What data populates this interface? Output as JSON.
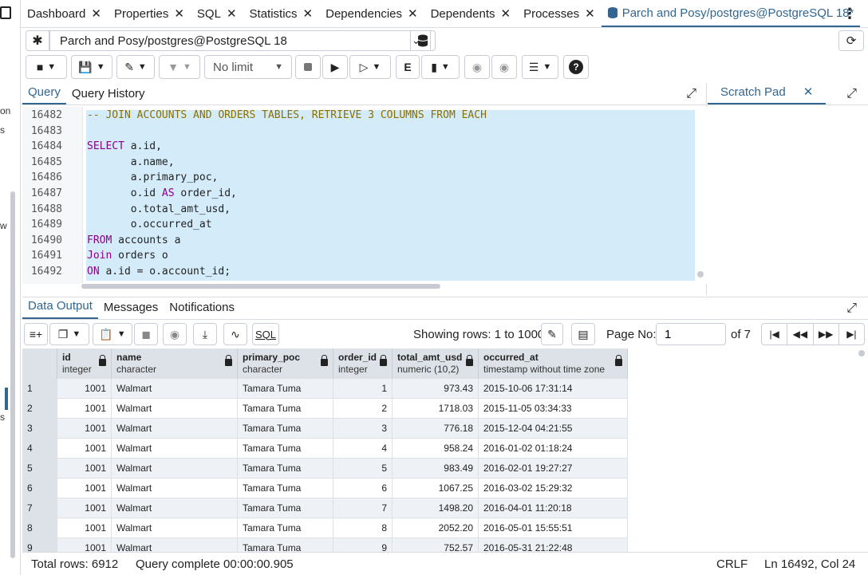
{
  "left_fragments": [
    "on",
    "s",
    "w",
    "s"
  ],
  "tabs": [
    {
      "label": "Dashboard",
      "active": false
    },
    {
      "label": "Properties",
      "active": false
    },
    {
      "label": "SQL",
      "active": false
    },
    {
      "label": "Statistics",
      "active": false
    },
    {
      "label": "Dependencies",
      "active": false
    },
    {
      "label": "Dependents",
      "active": false
    },
    {
      "label": "Processes",
      "active": false
    },
    {
      "label": "Parch and Posy/postgres@PostgreSQL 18*",
      "active": true
    }
  ],
  "connection": {
    "label": "Parch and Posy/postgres@PostgreSQL 18"
  },
  "toolbar": {
    "limit_label": "No limit"
  },
  "query_tabs": [
    "Query",
    "Query History"
  ],
  "scratch_pad": {
    "label": "Scratch Pad"
  },
  "editor": {
    "lines": [
      {
        "num": "16482",
        "text": "-- JOIN ACCOUNTS AND ORDERS TABLES, RETRIEVE 3 COLUMNS FROM EACH"
      },
      {
        "num": "16483",
        "text": ""
      },
      {
        "num": "16484",
        "text": "SELECT a.id,"
      },
      {
        "num": "16485",
        "text": "       a.name,"
      },
      {
        "num": "16486",
        "text": "       a.primary_poc,"
      },
      {
        "num": "16487",
        "text": "       o.id AS order_id,"
      },
      {
        "num": "16488",
        "text": "       o.total_amt_usd,"
      },
      {
        "num": "16489",
        "text": "       o.occurred_at"
      },
      {
        "num": "16490",
        "text": "FROM accounts a"
      },
      {
        "num": "16491",
        "text": "Join orders o"
      },
      {
        "num": "16492",
        "text": "ON a.id = o.account_id;"
      }
    ]
  },
  "output_tabs": [
    "Data Output",
    "Messages",
    "Notifications"
  ],
  "data_toolbar": {
    "sql_label": "SQL",
    "rows_text": "Showing rows: 1 to 1000",
    "page_label": "Page No:",
    "page_value": "1",
    "of_label": "of 7"
  },
  "grid": {
    "columns": [
      {
        "name": "id",
        "type": "integer"
      },
      {
        "name": "name",
        "type": "character"
      },
      {
        "name": "primary_poc",
        "type": "character"
      },
      {
        "name": "order_id",
        "type": "integer"
      },
      {
        "name": "total_amt_usd",
        "type": "numeric (10,2)"
      },
      {
        "name": "occurred_at",
        "type": "timestamp without time zone"
      }
    ],
    "rows": [
      [
        "1",
        "1001",
        "Walmart",
        "Tamara Tuma",
        "1",
        "973.43",
        "2015-10-06 17:31:14"
      ],
      [
        "2",
        "1001",
        "Walmart",
        "Tamara Tuma",
        "2",
        "1718.03",
        "2015-11-05 03:34:33"
      ],
      [
        "3",
        "1001",
        "Walmart",
        "Tamara Tuma",
        "3",
        "776.18",
        "2015-12-04 04:21:55"
      ],
      [
        "4",
        "1001",
        "Walmart",
        "Tamara Tuma",
        "4",
        "958.24",
        "2016-01-02 01:18:24"
      ],
      [
        "5",
        "1001",
        "Walmart",
        "Tamara Tuma",
        "5",
        "983.49",
        "2016-02-01 19:27:27"
      ],
      [
        "6",
        "1001",
        "Walmart",
        "Tamara Tuma",
        "6",
        "1067.25",
        "2016-03-02 15:29:32"
      ],
      [
        "7",
        "1001",
        "Walmart",
        "Tamara Tuma",
        "7",
        "1498.20",
        "2016-04-01 11:20:18"
      ],
      [
        "8",
        "1001",
        "Walmart",
        "Tamara Tuma",
        "8",
        "2052.20",
        "2016-05-01 15:55:51"
      ],
      [
        "9",
        "1001",
        "Walmart",
        "Tamara Tuma",
        "9",
        "752.57",
        "2016-05-31 21:22:48"
      ]
    ]
  },
  "status": {
    "total_rows": "Total rows: 6912",
    "query_status": "Query complete 00:00:00.905",
    "line_ending": "CRLF",
    "cursor": "Ln 16492, Col 24"
  },
  "colors": {
    "accent": "#326690",
    "selection": "#d4ecfa",
    "keyword": "#8b008b",
    "comment": "#8b6f00"
  }
}
